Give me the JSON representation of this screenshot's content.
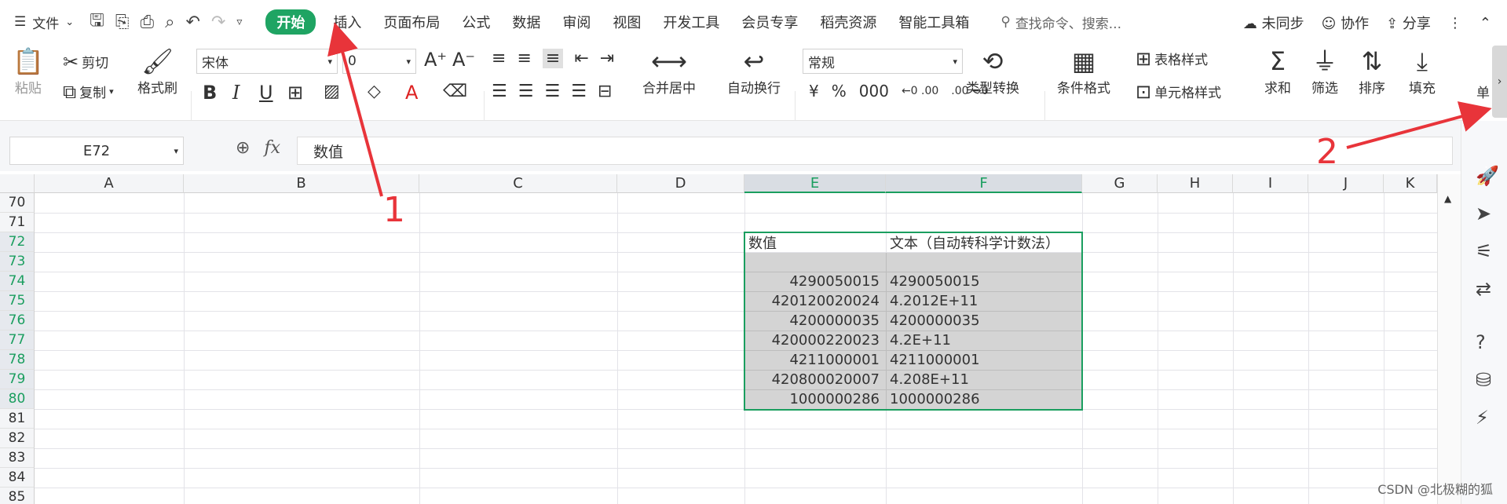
{
  "menubar": {
    "file": "文件",
    "tabs": [
      "开始",
      "插入",
      "页面布局",
      "公式",
      "数据",
      "审阅",
      "视图",
      "开发工具",
      "会员专享",
      "稻壳资源",
      "智能工具箱"
    ],
    "search_placeholder": "查找命令、搜索...",
    "sync": "未同步",
    "collab": "协作",
    "share": "分享"
  },
  "ribbon": {
    "paste": "粘贴",
    "cut": "剪切",
    "copy": "复制",
    "format_painter": "格式刷",
    "font_name": "宋体",
    "font_size": "0",
    "merge_center": "合并居中",
    "wrap_text": "自动换行",
    "number_format": "常规",
    "type_convert": "类型转换",
    "cond_format": "条件格式",
    "table_style": "表格样式",
    "cell_style": "单元格样式",
    "sum": "求和",
    "filter": "筛选",
    "sort": "排序",
    "fill": "填充",
    "single": "单"
  },
  "formula_bar": {
    "name_box": "E72",
    "fx": "fx",
    "content": "数值"
  },
  "columns": [
    "A",
    "B",
    "C",
    "D",
    "E",
    "F",
    "G",
    "H",
    "I",
    "J",
    "K"
  ],
  "rows": [
    "70",
    "71",
    "72",
    "73",
    "74",
    "75",
    "76",
    "77",
    "78",
    "79",
    "80",
    "81",
    "82",
    "83",
    "84",
    "85"
  ],
  "cells": {
    "e_header": "数值",
    "f_header": "文本（自动转科学计数法）",
    "e_values": [
      "4290050015",
      "420120020024",
      "4200000035",
      "420000220023",
      "4211000001",
      "420800020007",
      "1000000286"
    ],
    "f_values": [
      "4290050015",
      "4.2012E+11",
      "4200000035",
      "4.2E+11",
      "4211000001",
      "4.208E+11",
      "1000000286"
    ]
  },
  "annotations": [
    "1",
    "2"
  ],
  "watermark": "CSDN @北极糊的狐",
  "colors": {
    "accent": "#1fa463",
    "arrow": "#e8343a",
    "selection_fill": "#d4d4d4"
  }
}
